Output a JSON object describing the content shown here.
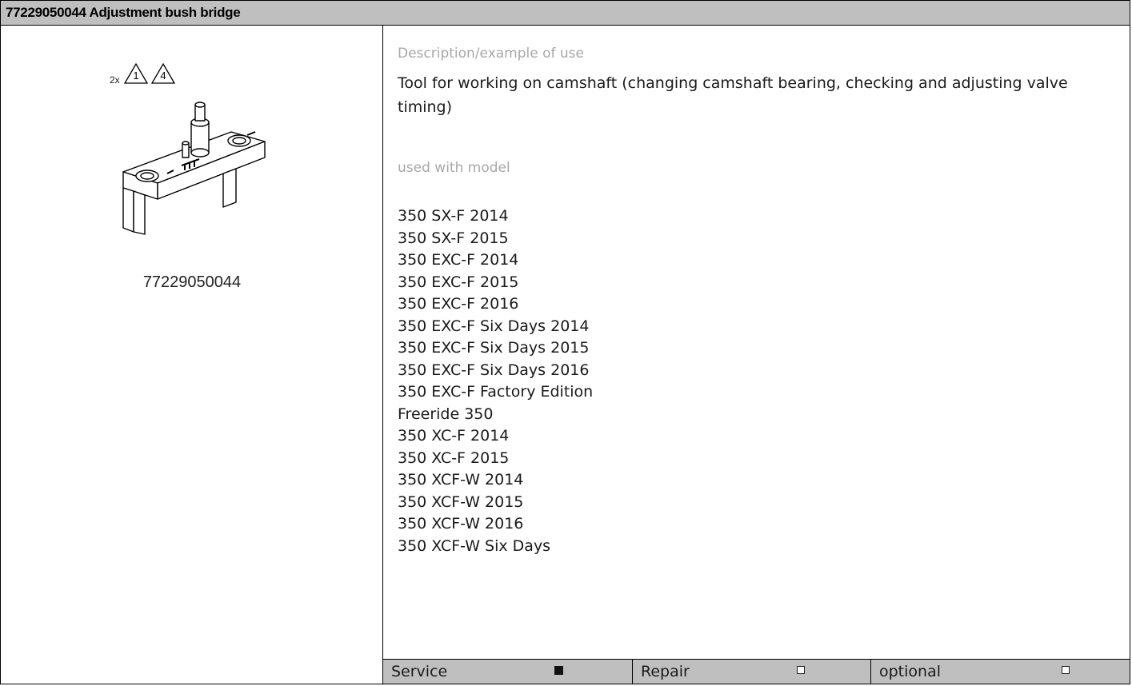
{
  "header": {
    "title": "77229050044 Adjustment bush bridge"
  },
  "figure": {
    "warning_count": "2x",
    "warning_icons": [
      {
        "icon": "warning-triangle-icon",
        "number": "1"
      },
      {
        "icon": "warning-triangle-icon",
        "number": "4"
      }
    ],
    "part_number": "77229050044"
  },
  "details": {
    "description_heading": "Description/example of use",
    "description": "Tool for working on camshaft (changing camshaft bearing, checking and adjusting valve timing)",
    "models_heading": "used with model",
    "models": [
      "350 SX-F 2014",
      "350 SX-F 2015",
      "350 EXC-F 2014",
      "350 EXC-F 2015",
      "350 EXC-F 2016",
      "350 EXC-F Six Days 2014",
      "350 EXC-F Six Days 2015",
      "350 EXC-F Six Days 2016",
      "350 EXC-F Factory Edition",
      "Freeride 350",
      "350 XC-F 2014",
      "350 XC-F 2015",
      "350 XCF-W 2014",
      "350 XCF-W 2015",
      "350 XCF-W 2016",
      "350 XCF-W Six Days"
    ]
  },
  "categories": [
    {
      "label": "Service",
      "checked": true
    },
    {
      "label": "Repair",
      "checked": false
    },
    {
      "label": "optional",
      "checked": false
    }
  ]
}
